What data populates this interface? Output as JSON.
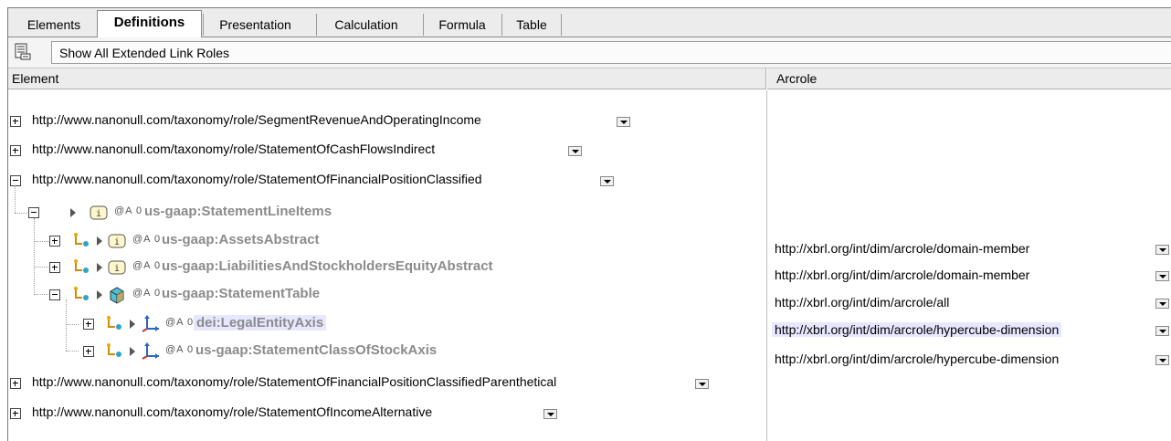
{
  "tabs": [
    {
      "label": "Elements"
    },
    {
      "label": "Definitions",
      "active": true
    },
    {
      "label": "Presentation"
    },
    {
      "label": "Calculation"
    },
    {
      "label": "Formula"
    },
    {
      "label": "Table"
    }
  ],
  "toolbar": {
    "show_all_label": "Show All Extended Link Roles"
  },
  "columns": {
    "element": "Element",
    "arcrole": "Arcrole"
  },
  "roles": [
    "http://www.nanonull.com/taxonomy/role/SegmentRevenueAndOperatingIncome",
    "http://www.nanonull.com/taxonomy/role/StatementOfCashFlowsIndirect",
    "http://www.nanonull.com/taxonomy/role/StatementOfFinancialPositionClassified",
    "http://www.nanonull.com/taxonomy/role/StatementOfFinancialPositionClassifiedParenthetical",
    "http://www.nanonull.com/taxonomy/role/StatementOfIncomeAlternative"
  ],
  "badge_text": "@A 0",
  "tree": [
    {
      "name": "us-gaap:StatementLineItems",
      "arcrole": ""
    },
    {
      "name": "us-gaap:AssetsAbstract",
      "arcrole": "http://xbrl.org/int/dim/arcrole/domain-member"
    },
    {
      "name": "us-gaap:LiabilitiesAndStockholdersEquityAbstract",
      "arcrole": "http://xbrl.org/int/dim/arcrole/domain-member"
    },
    {
      "name": "us-gaap:StatementTable",
      "arcrole": "http://xbrl.org/int/dim/arcrole/all"
    },
    {
      "name": "dei:LegalEntityAxis",
      "arcrole": "http://xbrl.org/int/dim/arcrole/hypercube-dimension",
      "selected": true
    },
    {
      "name": "us-gaap:StatementClassOfStockAxis",
      "arcrole": "http://xbrl.org/int/dim/arcrole/hypercube-dimension"
    }
  ],
  "colors": {
    "selection": "#e7e7ff",
    "element_text": "#8b8b8b",
    "cube_teal": "#2aa3b8"
  }
}
